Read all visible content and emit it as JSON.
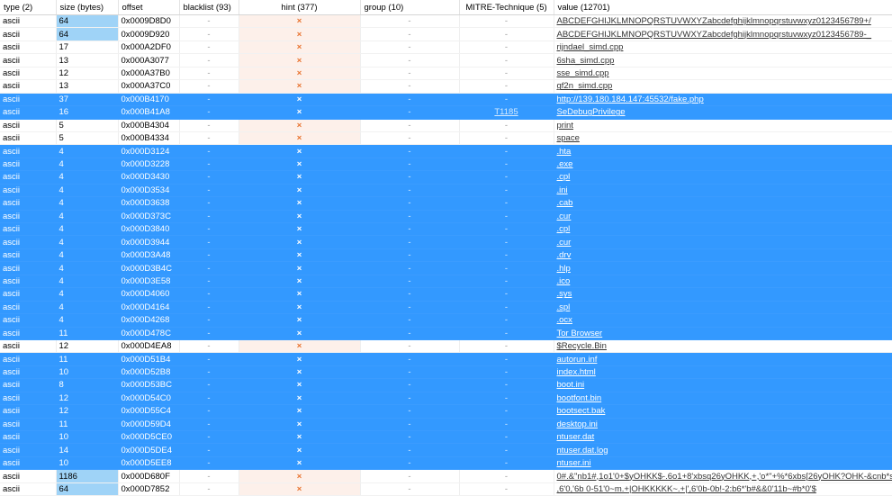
{
  "columns": [
    "type (2)",
    "size (bytes)",
    "offset",
    "blacklist (93)",
    "hint (377)",
    "group (10)",
    "MITRE-Technique (5)",
    "value (12701)"
  ],
  "rows": [
    {
      "type": "ascii",
      "size": "64",
      "offset": "0x0009D8D0",
      "blacklist": "-",
      "hint": "×",
      "group": "-",
      "mitre": "-",
      "value": "ABCDEFGHIJKLMNOPQRSTUVWXYZabcdefghijklmnopqrstuvwxyz0123456789+/",
      "selected": false,
      "size_hl": true
    },
    {
      "type": "ascii",
      "size": "64",
      "offset": "0x0009D920",
      "blacklist": "-",
      "hint": "×",
      "group": "-",
      "mitre": "-",
      "value": "ABCDEFGHIJKLMNOPQRSTUVWXYZabcdefghijklmnopqrstuvwxyz0123456789-_",
      "selected": false,
      "size_hl": true
    },
    {
      "type": "ascii",
      "size": "17",
      "offset": "0x000A2DF0",
      "blacklist": "-",
      "hint": "×",
      "group": "-",
      "mitre": "-",
      "value": "rijndael_simd.cpp",
      "selected": false,
      "size_hl": false
    },
    {
      "type": "ascii",
      "size": "13",
      "offset": "0x000A3077",
      "blacklist": "-",
      "hint": "×",
      "group": "-",
      "mitre": "-",
      "value": "6sha_simd.cpp",
      "selected": false,
      "size_hl": false
    },
    {
      "type": "ascii",
      "size": "12",
      "offset": "0x000A37B0",
      "blacklist": "-",
      "hint": "×",
      "group": "-",
      "mitre": "-",
      "value": "sse_simd.cpp",
      "selected": false,
      "size_hl": false
    },
    {
      "type": "ascii",
      "size": "13",
      "offset": "0x000A37C0",
      "blacklist": "-",
      "hint": "×",
      "group": "-",
      "mitre": "-",
      "value": "gf2n_simd.cpp",
      "selected": false,
      "size_hl": false
    },
    {
      "type": "ascii",
      "size": "37",
      "offset": "0x000B4170",
      "blacklist": "-",
      "hint": "×",
      "group": "-",
      "mitre": "-",
      "value": "http://139.180.184.147:45532/fake.php",
      "selected": true,
      "size_hl": false
    },
    {
      "type": "ascii",
      "size": "16",
      "offset": "0x000B41A8",
      "blacklist": "-",
      "hint": "×",
      "group": "-",
      "mitre": "T1185",
      "value": "SeDebugPrivilege",
      "selected": true,
      "size_hl": false
    },
    {
      "type": "ascii",
      "size": "5",
      "offset": "0x000B4304",
      "blacklist": "-",
      "hint": "×",
      "group": "-",
      "mitre": "-",
      "value": "print",
      "selected": false,
      "size_hl": false
    },
    {
      "type": "ascii",
      "size": "5",
      "offset": "0x000B4334",
      "blacklist": "-",
      "hint": "×",
      "group": "-",
      "mitre": "-",
      "value": "space",
      "selected": false,
      "size_hl": false
    },
    {
      "type": "ascii",
      "size": "4",
      "offset": "0x000D3124",
      "blacklist": "-",
      "hint": "×",
      "group": "-",
      "mitre": "-",
      "value": ".hta",
      "selected": true,
      "size_hl": false
    },
    {
      "type": "ascii",
      "size": "4",
      "offset": "0x000D3228",
      "blacklist": "-",
      "hint": "×",
      "group": "-",
      "mitre": "-",
      "value": ".exe",
      "selected": true,
      "size_hl": false
    },
    {
      "type": "ascii",
      "size": "4",
      "offset": "0x000D3430",
      "blacklist": "-",
      "hint": "×",
      "group": "-",
      "mitre": "-",
      "value": ".cpl",
      "selected": true,
      "size_hl": false
    },
    {
      "type": "ascii",
      "size": "4",
      "offset": "0x000D3534",
      "blacklist": "-",
      "hint": "×",
      "group": "-",
      "mitre": "-",
      "value": ".ini",
      "selected": true,
      "size_hl": false
    },
    {
      "type": "ascii",
      "size": "4",
      "offset": "0x000D3638",
      "blacklist": "-",
      "hint": "×",
      "group": "-",
      "mitre": "-",
      "value": ".cab",
      "selected": true,
      "size_hl": false
    },
    {
      "type": "ascii",
      "size": "4",
      "offset": "0x000D373C",
      "blacklist": "-",
      "hint": "×",
      "group": "-",
      "mitre": "-",
      "value": ".cur",
      "selected": true,
      "size_hl": false
    },
    {
      "type": "ascii",
      "size": "4",
      "offset": "0x000D3840",
      "blacklist": "-",
      "hint": "×",
      "group": "-",
      "mitre": "-",
      "value": ".cpl",
      "selected": true,
      "size_hl": false
    },
    {
      "type": "ascii",
      "size": "4",
      "offset": "0x000D3944",
      "blacklist": "-",
      "hint": "×",
      "group": "-",
      "mitre": "-",
      "value": ".cur",
      "selected": true,
      "size_hl": false
    },
    {
      "type": "ascii",
      "size": "4",
      "offset": "0x000D3A48",
      "blacklist": "-",
      "hint": "×",
      "group": "-",
      "mitre": "-",
      "value": ".drv",
      "selected": true,
      "size_hl": false
    },
    {
      "type": "ascii",
      "size": "4",
      "offset": "0x000D3B4C",
      "blacklist": "-",
      "hint": "×",
      "group": "-",
      "mitre": "-",
      "value": ".hlp",
      "selected": true,
      "size_hl": false
    },
    {
      "type": "ascii",
      "size": "4",
      "offset": "0x000D3E58",
      "blacklist": "-",
      "hint": "×",
      "group": "-",
      "mitre": "-",
      "value": ".ico",
      "selected": true,
      "size_hl": false
    },
    {
      "type": "ascii",
      "size": "4",
      "offset": "0x000D4060",
      "blacklist": "-",
      "hint": "×",
      "group": "-",
      "mitre": "-",
      "value": ".sys",
      "selected": true,
      "size_hl": false
    },
    {
      "type": "ascii",
      "size": "4",
      "offset": "0x000D4164",
      "blacklist": "-",
      "hint": "×",
      "group": "-",
      "mitre": "-",
      "value": ".spl",
      "selected": true,
      "size_hl": false
    },
    {
      "type": "ascii",
      "size": "4",
      "offset": "0x000D4268",
      "blacklist": "-",
      "hint": "×",
      "group": "-",
      "mitre": "-",
      "value": ".ocx",
      "selected": true,
      "size_hl": false
    },
    {
      "type": "ascii",
      "size": "11",
      "offset": "0x000D478C",
      "blacklist": "-",
      "hint": "×",
      "group": "-",
      "mitre": "-",
      "value": "Tor Browser",
      "selected": true,
      "size_hl": false
    },
    {
      "type": "ascii",
      "size": "12",
      "offset": "0x000D4EA8",
      "blacklist": "-",
      "hint": "×",
      "group": "-",
      "mitre": "-",
      "value": "$Recycle.Bin",
      "selected": false,
      "size_hl": false
    },
    {
      "type": "ascii",
      "size": "11",
      "offset": "0x000D51B4",
      "blacklist": "-",
      "hint": "×",
      "group": "-",
      "mitre": "-",
      "value": "autorun.inf",
      "selected": true,
      "size_hl": false
    },
    {
      "type": "ascii",
      "size": "10",
      "offset": "0x000D52B8",
      "blacklist": "-",
      "hint": "×",
      "group": "-",
      "mitre": "-",
      "value": "index.html",
      "selected": true,
      "size_hl": false
    },
    {
      "type": "ascii",
      "size": "8",
      "offset": "0x000D53BC",
      "blacklist": "-",
      "hint": "×",
      "group": "-",
      "mitre": "-",
      "value": "boot.ini",
      "selected": true,
      "size_hl": false
    },
    {
      "type": "ascii",
      "size": "12",
      "offset": "0x000D54C0",
      "blacklist": "-",
      "hint": "×",
      "group": "-",
      "mitre": "-",
      "value": "bootfont.bin",
      "selected": true,
      "size_hl": false
    },
    {
      "type": "ascii",
      "size": "12",
      "offset": "0x000D55C4",
      "blacklist": "-",
      "hint": "×",
      "group": "-",
      "mitre": "-",
      "value": "bootsect.bak",
      "selected": true,
      "size_hl": false
    },
    {
      "type": "ascii",
      "size": "11",
      "offset": "0x000D59D4",
      "blacklist": "-",
      "hint": "×",
      "group": "-",
      "mitre": "-",
      "value": "desktop.ini",
      "selected": true,
      "size_hl": false
    },
    {
      "type": "ascii",
      "size": "10",
      "offset": "0x000D5CE0",
      "blacklist": "-",
      "hint": "×",
      "group": "-",
      "mitre": "-",
      "value": "ntuser.dat",
      "selected": true,
      "size_hl": false
    },
    {
      "type": "ascii",
      "size": "14",
      "offset": "0x000D5DE4",
      "blacklist": "-",
      "hint": "×",
      "group": "-",
      "mitre": "-",
      "value": "ntuser.dat.log",
      "selected": true,
      "size_hl": false
    },
    {
      "type": "ascii",
      "size": "10",
      "offset": "0x000D5EE8",
      "blacklist": "-",
      "hint": "×",
      "group": "-",
      "mitre": "-",
      "value": "ntuser.ini",
      "selected": true,
      "size_hl": false
    },
    {
      "type": "ascii",
      "size": "1186",
      "offset": "0x000D680F",
      "blacklist": "-",
      "hint": "×",
      "group": "-",
      "mitre": "-",
      "value": "0#.&\"nb1#,1o1'0+$yOHKK$-.6o1+8'xbsq26yOHKK,+,'o*\"+%*6xbs[26yOHK?OHK-&cnb*sb9...",
      "selected": false,
      "size_hl": true
    },
    {
      "type": "ascii",
      "size": "64",
      "offset": "0x000D7852",
      "blacklist": "-",
      "hint": "×",
      "group": "-",
      "mitre": "-",
      "value": ",6'0,'6b 0-51'0~m.+|OHKKKKK~.+|',6'0b-0b!-2:b6*'b#&&0'11b~#b*0'$",
      "selected": false,
      "size_hl": true
    }
  ]
}
